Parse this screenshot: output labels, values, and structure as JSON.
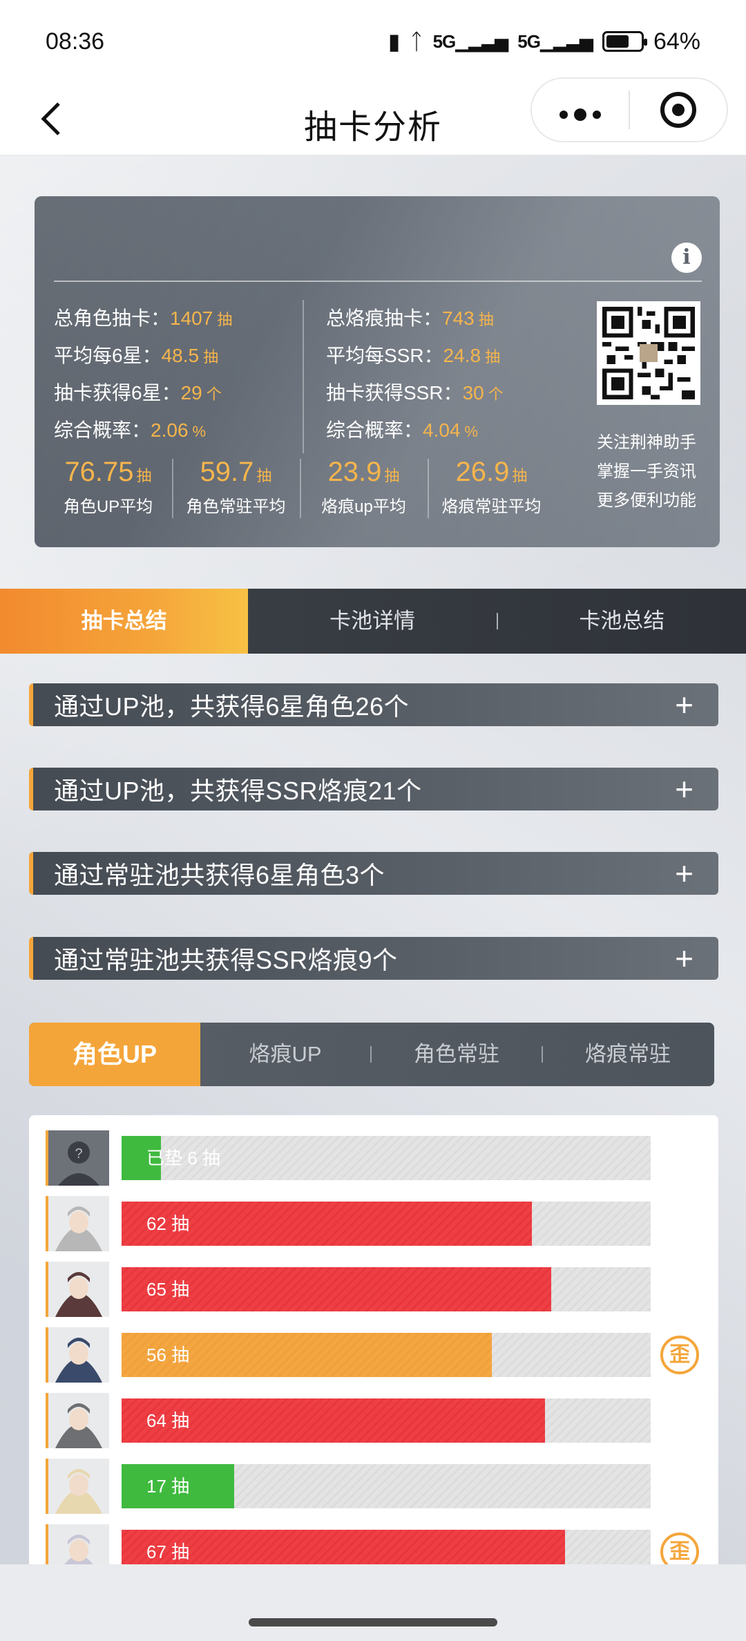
{
  "status_bar": {
    "time": "08:36",
    "signal_1": "5G",
    "signal_2": "5G",
    "battery": "64%",
    "battery_level": 0.64
  },
  "nav": {
    "title": "抽卡分析",
    "back_icon": "chevron-left-icon",
    "more_icon": "more-dots-icon",
    "close_icon": "target-circle-icon"
  },
  "stats": {
    "left": [
      {
        "label": "总角色抽卡：",
        "value": "1407",
        "unit": "抽"
      },
      {
        "label": "平均每6星：",
        "value": "48.5",
        "unit": "抽"
      },
      {
        "label": "抽卡获得6星：",
        "value": "29",
        "unit": "个"
      },
      {
        "label": "综合概率：",
        "value": "2.06",
        "unit": "%"
      }
    ],
    "right": [
      {
        "label": "总烙痕抽卡：",
        "value": "743",
        "unit": "抽"
      },
      {
        "label": "平均每SSR：",
        "value": "24.8",
        "unit": "抽"
      },
      {
        "label": "抽卡获得SSR：",
        "value": "30",
        "unit": "个"
      },
      {
        "label": "综合概率：",
        "value": "4.04",
        "unit": "%"
      }
    ],
    "averages": [
      {
        "value": "76.75",
        "unit": "抽",
        "label": "角色UP平均"
      },
      {
        "value": "59.7",
        "unit": "抽",
        "label": "角色常驻平均"
      },
      {
        "value": "23.9",
        "unit": "抽",
        "label": "烙痕up平均"
      },
      {
        "value": "26.9",
        "unit": "抽",
        "label": "烙痕常驻平均"
      }
    ],
    "qr_caption": [
      "关注荆神助手",
      "掌握一手资讯",
      "更多便利功能"
    ]
  },
  "main_tabs": [
    "抽卡总结",
    "卡池详情",
    "卡池总结"
  ],
  "accordion": [
    "通过UP池，共获得6星角色26个",
    "通过UP池，共获得SSR烙痕21个",
    "通过常驻池共获得6星角色3个",
    "通过常驻池共获得SSR烙痕9个"
  ],
  "sub_tabs": [
    "角色UP",
    "烙痕UP",
    "角色常驻",
    "烙痕常驻"
  ],
  "pulls": [
    {
      "label": "已垫 6 抽",
      "value": 6,
      "color": "#3fba3f",
      "type": "green",
      "wai": false,
      "avatar": "unknown"
    },
    {
      "label": "62 抽",
      "value": 62,
      "color": "#ee3f45",
      "type": "red",
      "wai": false,
      "avatar": "char"
    },
    {
      "label": "65 抽",
      "value": 65,
      "color": "#ee3f45",
      "type": "red",
      "wai": false,
      "avatar": "char"
    },
    {
      "label": "56 抽",
      "value": 56,
      "color": "#f4a640",
      "type": "orange",
      "wai": true,
      "avatar": "char"
    },
    {
      "label": "64 抽",
      "value": 64,
      "color": "#ee3f45",
      "type": "red",
      "wai": false,
      "avatar": "char"
    },
    {
      "label": "17 抽",
      "value": 17,
      "color": "#3fba3f",
      "type": "green",
      "wai": false,
      "avatar": "char"
    },
    {
      "label": "67 抽",
      "value": 67,
      "color": "#ee3f45",
      "type": "red",
      "wai": true,
      "avatar": "char"
    }
  ],
  "pull_max": 80,
  "wai_text": "歪",
  "colors": {
    "accent": "#f4a53a",
    "red": "#ee3f45",
    "green": "#3fba3f"
  }
}
